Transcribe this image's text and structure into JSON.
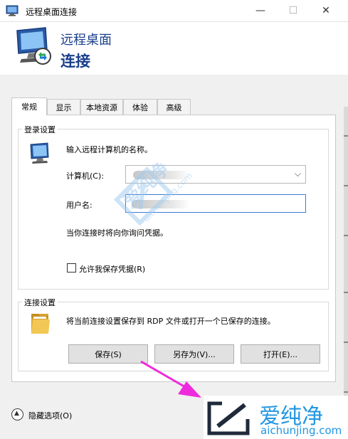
{
  "window": {
    "title": "远程桌面连接",
    "min_glyph": "—",
    "max_glyph": "☐",
    "close_glyph": "✕",
    "icon": "remote-desktop-icon"
  },
  "banner": {
    "line1": "远程桌面",
    "line2": "连接"
  },
  "tabs": [
    {
      "label": "常规",
      "active": true
    },
    {
      "label": "显示",
      "active": false
    },
    {
      "label": "本地资源",
      "active": false
    },
    {
      "label": "体验",
      "active": false
    },
    {
      "label": "高级",
      "active": false
    }
  ],
  "login_group": {
    "legend": "登录设置",
    "instruction": "输入远程计算机的名称。",
    "computer_label": "计算机(C):",
    "computer_value": "",
    "user_label": "用户名:",
    "user_value": "",
    "hint": "当你连接时将向你询问凭据。",
    "save_credentials_label": "允许我保存凭据(R)",
    "save_credentials_checked": false
  },
  "connect_group": {
    "legend": "连接设置",
    "description": "将当前连接设置保存到 RDP 文件或打开一个已保存的连接。",
    "save_button": "保存(S)",
    "save_as_button": "另存为(V)...",
    "open_button": "打开(E)..."
  },
  "footer": {
    "toggle_label": "隐藏选项(O)",
    "toggle_glyph": "▲"
  },
  "watermark": {
    "text": "爱纯净",
    "url": "aichunjing.com"
  },
  "branding": {
    "name": "爱纯净",
    "url": "aichunjing.com"
  },
  "colors": {
    "accent": "#1a3f8c",
    "arrow": "#ee2bdc",
    "brand": "#2196e3",
    "focus": "#3a7bd5"
  }
}
